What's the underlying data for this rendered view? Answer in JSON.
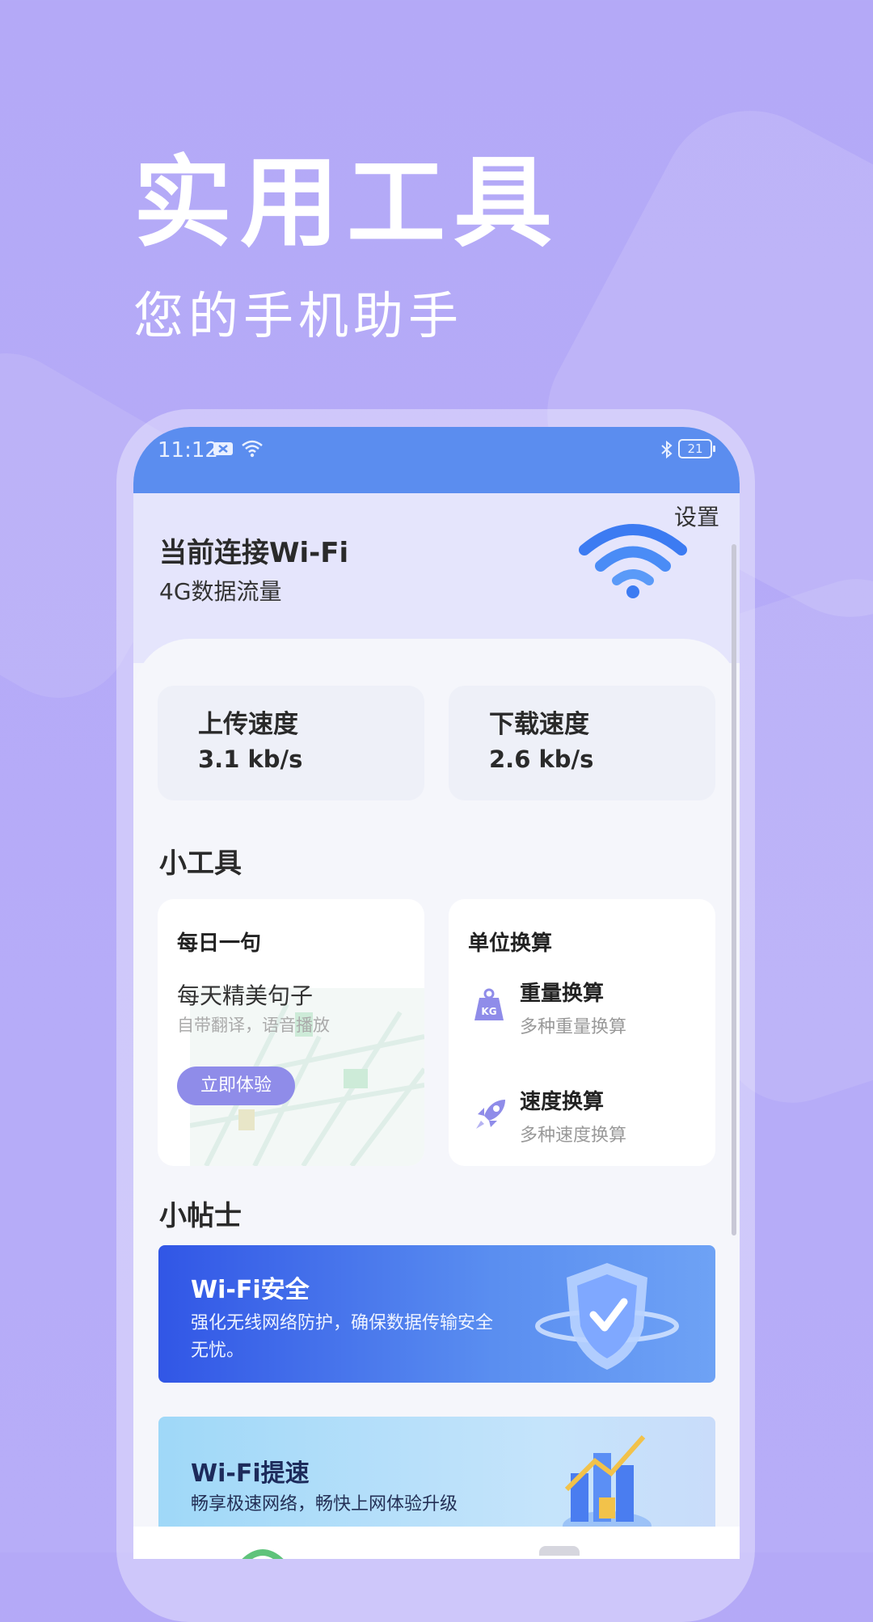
{
  "hero": {
    "title": "实用工具",
    "subtitle": "您的手机助手"
  },
  "statusbar": {
    "time": "11:12",
    "battery": "21"
  },
  "header": {
    "settings_label": "设置",
    "wifi_title": "当前连接Wi-Fi",
    "wifi_subtitle": "4G数据流量"
  },
  "speed": {
    "upload_label": "上传速度",
    "upload_value": "3.1 kb/s",
    "download_label": "下载速度",
    "download_value": "2.6 kb/s"
  },
  "tools": {
    "section_title": "小工具",
    "daily": {
      "title": "每日一句",
      "line": "每天精美句子",
      "sub": "自带翻译，语音播放",
      "button": "立即体验"
    },
    "unit": {
      "title": "单位换算",
      "items": [
        {
          "name": "重量换算",
          "desc": "多种重量换算",
          "icon": "kg-weight-icon"
        },
        {
          "name": "速度换算",
          "desc": "多种速度换算",
          "icon": "rocket-icon"
        }
      ]
    }
  },
  "tips": {
    "section_title": "小帖士",
    "cards": [
      {
        "title": "Wi-Fi安全",
        "desc": "强化无线网络防护，确保数据传输安全无忧。",
        "icon": "shield-icon"
      },
      {
        "title": "Wi-Fi提速",
        "desc": "畅享极速网络，畅快上网体验升级",
        "icon": "chart-growth-icon"
      }
    ]
  },
  "colors": {
    "statusbar": "#5b8def",
    "accent": "#8f8ce9",
    "background": "#b4a9f7"
  }
}
